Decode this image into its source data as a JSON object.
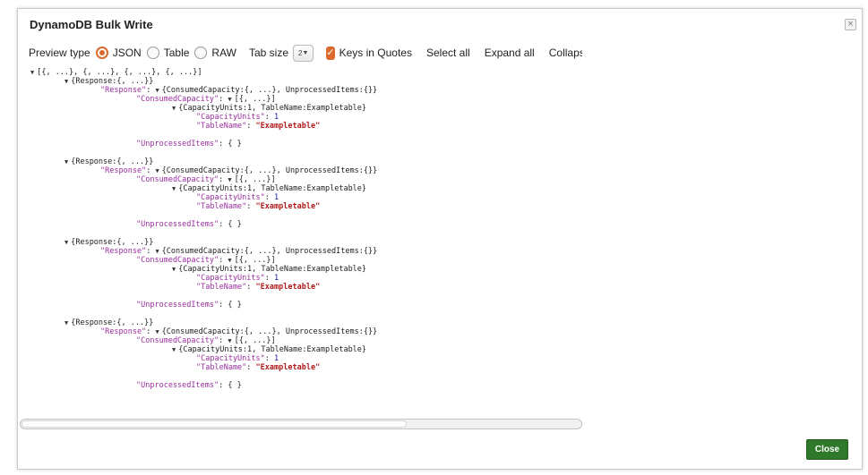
{
  "dialog": {
    "title": "DynamoDB Bulk Write",
    "close_glyph": "×",
    "close_button_label": "Close"
  },
  "toolbar": {
    "preview_type_label": "Preview type",
    "options": [
      {
        "label": "JSON",
        "checked": true
      },
      {
        "label": "Table",
        "checked": false
      },
      {
        "label": "RAW",
        "checked": false
      }
    ],
    "tab_size_label": "Tab size",
    "tab_size_value": "2",
    "keys_in_quotes_label": "Keys in Quotes",
    "keys_in_quotes_checked": true,
    "select_all_label": "Select all",
    "expand_all_label": "Expand all",
    "collapse_all_label": "Collapse all"
  },
  "json_tree": {
    "root_summary": "[{, ...}, {, ...}, {, ...}, {, ...}]",
    "items": [
      {
        "summary": "{Response:{, ...}}",
        "response_key": "\"Response\"",
        "response_summary": "{ConsumedCapacity:{, ...}, UnprocessedItems:{}}",
        "consumed_key": "\"ConsumedCapacity\"",
        "consumed_summary": "[{, ...}]",
        "entry_summary": "{CapacityUnits:1, TableName:Exampletable}",
        "capacity_key": "\"CapacityUnits\"",
        "capacity_value": "1",
        "table_key": "\"TableName\"",
        "table_value": "\"Exampletable\"",
        "unprocessed_key": "\"UnprocessedItems\"",
        "unprocessed_value": "{ }"
      },
      {
        "summary": "{Response:{, ...}}",
        "response_key": "\"Response\"",
        "response_summary": "{ConsumedCapacity:{, ...}, UnprocessedItems:{}}",
        "consumed_key": "\"ConsumedCapacity\"",
        "consumed_summary": "[{, ...}]",
        "entry_summary": "{CapacityUnits:1, TableName:Exampletable}",
        "capacity_key": "\"CapacityUnits\"",
        "capacity_value": "1",
        "table_key": "\"TableName\"",
        "table_value": "\"Exampletable\"",
        "unprocessed_key": "\"UnprocessedItems\"",
        "unprocessed_value": "{ }"
      },
      {
        "summary": "{Response:{, ...}}",
        "response_key": "\"Response\"",
        "response_summary": "{ConsumedCapacity:{, ...}, UnprocessedItems:{}}",
        "consumed_key": "\"ConsumedCapacity\"",
        "consumed_summary": "[{, ...}]",
        "entry_summary": "{CapacityUnits:1, TableName:Exampletable}",
        "capacity_key": "\"CapacityUnits\"",
        "capacity_value": "1",
        "table_key": "\"TableName\"",
        "table_value": "\"Exampletable\"",
        "unprocessed_key": "\"UnprocessedItems\"",
        "unprocessed_value": "{ }"
      },
      {
        "summary": "{Response:{, ...}}",
        "response_key": "\"Response\"",
        "response_summary": "{ConsumedCapacity:{, ...}, UnprocessedItems:{}}",
        "consumed_key": "\"ConsumedCapacity\"",
        "consumed_summary": "[{, ...}]",
        "entry_summary": "{CapacityUnits:1, TableName:Exampletable}",
        "capacity_key": "\"CapacityUnits\"",
        "capacity_value": "1",
        "table_key": "\"TableName\"",
        "table_value": "\"Exampletable\"",
        "unprocessed_key": "\"UnprocessedItems\"",
        "unprocessed_value": "{ }"
      }
    ]
  },
  "icons": {
    "expanded": "expanded-triangle-icon",
    "close": "close-icon",
    "check": "check-icon",
    "caret": "caret-down-icon"
  },
  "colors": {
    "accent": "#dd6a2c",
    "key": "#9c2fa0",
    "string": "#b11b1b",
    "number": "#1a1aa6",
    "close_button": "#2f7a2a"
  }
}
